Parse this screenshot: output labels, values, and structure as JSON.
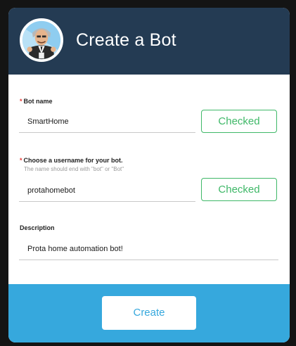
{
  "header": {
    "title": "Create a Bot",
    "avatar_icon": "bot-avatar-icon"
  },
  "fields": {
    "bot_name": {
      "required_mark": "*",
      "label": "Bot name",
      "value": "SmartHome",
      "status_button": "Checked"
    },
    "username": {
      "required_mark": "*",
      "label": "Choose a username for your bot.",
      "hint": "The name should end with \"bot\" or \"Bot\"",
      "value": "protahomebot",
      "status_button": "Checked"
    },
    "description": {
      "label": "Description",
      "value": "Prota home automation bot!"
    }
  },
  "footer": {
    "create_label": "Create"
  },
  "colors": {
    "header_bg": "#243b53",
    "footer_bg": "#36a8dd",
    "checked_green": "#3fb868",
    "required_red": "#e53935"
  }
}
